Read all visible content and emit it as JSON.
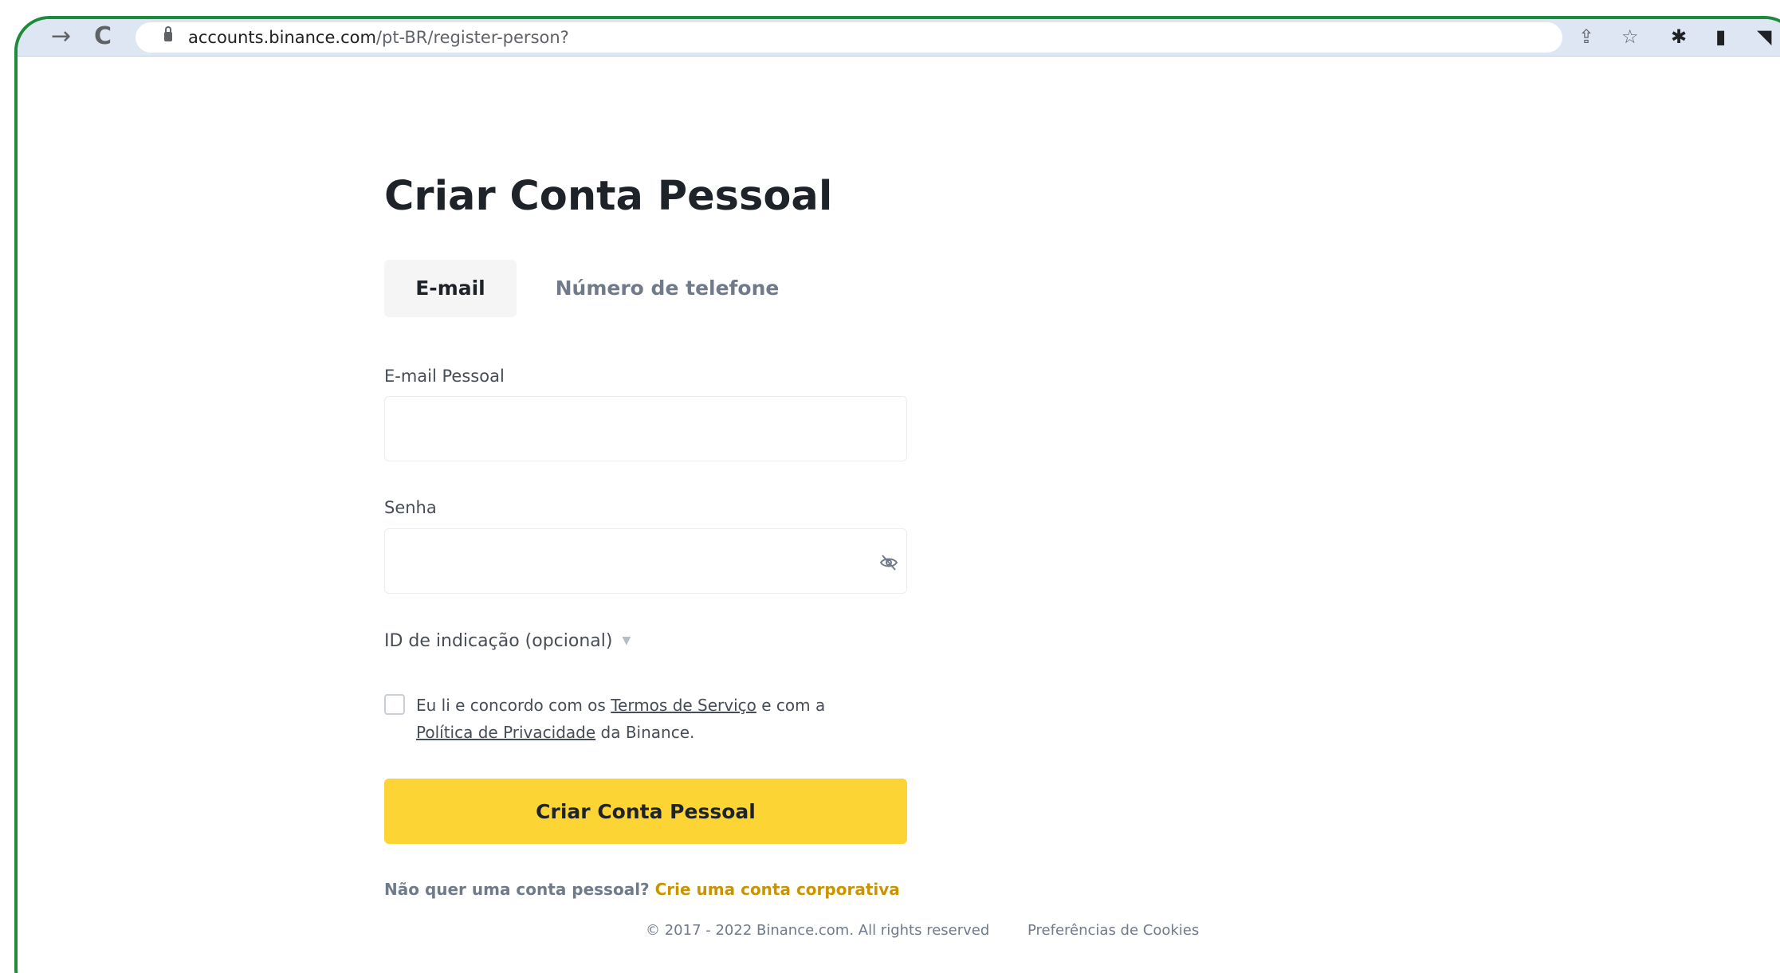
{
  "browser": {
    "url_host": "accounts.binance.com",
    "url_path": "/pt-BR/register-person?",
    "forward_icon": "arrow-forward-icon",
    "reload_icon": "reload-icon",
    "share_icon": "share-icon",
    "star_icon": "star-icon",
    "extensions_icon": "puzzle-icon",
    "sidepanel_icon": "side-panel-icon"
  },
  "page": {
    "title": "Criar Conta Pessoal"
  },
  "tabs": [
    {
      "label": "E-mail",
      "active": true
    },
    {
      "label": "Número de telefone",
      "active": false
    }
  ],
  "form": {
    "email_label": "E-mail Pessoal",
    "email_value": "",
    "password_label": "Senha",
    "password_value": "",
    "referral_label": "ID de indicação (opcional)",
    "terms": {
      "prefix": "Eu li e concordo com os ",
      "terms_link": "Termos de Serviço",
      "middle": " e com a ",
      "privacy_link": "Política de Privacidade",
      "suffix": " da Binance."
    },
    "submit_label": "Criar Conta Pessoal",
    "corporate_prompt": "Não quer uma conta pessoal? ",
    "corporate_link": "Crie uma conta corporativa"
  },
  "footer": {
    "copyright": "© 2017 - 2022 Binance.com. All rights reserved",
    "cookies": "Preferências de Cookies"
  },
  "colors": {
    "accent_yellow": "#fcd535",
    "link_gold": "#c99400",
    "frame_green": "#1e8a3c",
    "text_dark": "#1e2329"
  }
}
